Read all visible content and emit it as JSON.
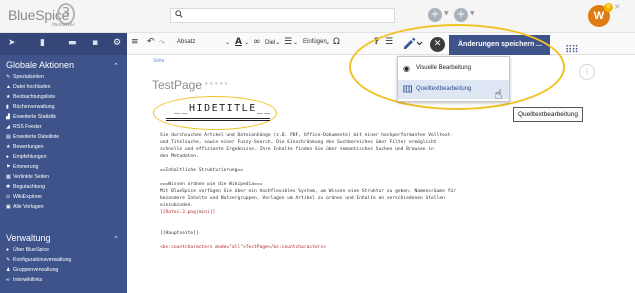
{
  "header": {
    "logo": "BlueSpice",
    "logo_number": "3",
    "logo_sub": "MediaWiki",
    "search_icon": "search-icon",
    "avatar_initial": "W",
    "avatar_badge": "8"
  },
  "sidebar": {
    "global_actions_title": "Globale Aktionen",
    "global_actions": [
      "Spezialseiten",
      "Datei hochladen",
      "Beobachtungsliste",
      "Bücherverwaltung",
      "Erweiterte Statistik",
      "RSS Feeder",
      "Erweiterte Dateiliste",
      "Bewertungen",
      "Empfehlungen",
      "Erinnerung",
      "Verlinkte Seiten",
      "Begutachtung",
      "WikiExplorer",
      "Alle Vorlagen"
    ],
    "admin_title": "Verwaltung",
    "admin": [
      "Über BlueSpice",
      "Konfigurationsverwaltung",
      "Gruppenverwaltung",
      "Interwikilinks"
    ]
  },
  "toolbar": {
    "format_label": "Absatz",
    "special_label": "Einfügen",
    "undo_icon": "undo-icon",
    "redo_icon": "redo-icon"
  },
  "content": {
    "breadcrumb": "Seite",
    "page_title": "TestPage",
    "hidetitle": "__HIDETITLE__",
    "lines": [
      "Sie durchsuchen Artikel und Dateianhänge (z.B. PDF, Office-Dokumente) mit einer hochperformanten Volltext-",
      "und Titelsuche, sowie einer Fuzzy-Search. Die Einschränkung des Suchbereiches über Filter ermöglicht",
      "schnelle und effiziente Ergebnisse. Ihre Inhalte finden Sie über semantisches Suchen und Browsen in",
      "den Metadaten.",
      "",
      "==Inhaltliche Strukturierung==",
      "",
      "===Wissen ordnen wie die Wikipedia===",
      "Mit BlueSpice verfügen Sie über ein hochflexibles System, um Wissen eine Struktur zu geben. Namensräume für",
      "besondere Inhalte und Nutzergruppen, Vorlagen um Artikel zu ordnen und Inhalte an verschiedenen Stellen",
      "einzubinden.",
      "[[Datei:3.png|mini]]",
      "",
      "",
      "[[Hauptseite]]",
      "",
      "<bs:countcharacters mode=\"all\">TestPage</bs:countcharacters>"
    ]
  },
  "edit": {
    "save_label": "Änderungen speichern ...",
    "dropdown": [
      {
        "label": "Visuelle Bearbeitung",
        "icon": "eye-icon"
      },
      {
        "label": "Quelltextbearbeitung",
        "icon": "source-code-icon"
      }
    ],
    "tooltip": "Quelltextbearbeitung"
  },
  "colors": {
    "sidebar_bg": "#3e5389",
    "highlight": "#f0c224",
    "avatar": "#e07c14"
  }
}
